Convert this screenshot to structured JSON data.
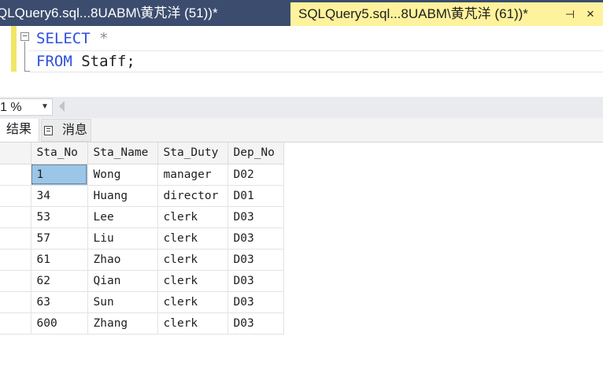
{
  "tabs": {
    "inactive_title": "QLQuery6.sql...8UABM\\黄芃洋 (51))*",
    "active_title": "SQLQuery5.sql...8UABM\\黄芃洋 (61))*",
    "pin_glyph": "⊣",
    "close_glyph": "×"
  },
  "editor": {
    "line1": {
      "keyword": "SELECT",
      "operator": "*"
    },
    "line2": {
      "keyword": "FROM",
      "identifier": "Staff;"
    }
  },
  "zoom": {
    "value": "1 %"
  },
  "result_tabs": {
    "results_label": "结果",
    "messages_label": "消息"
  },
  "grid": {
    "columns": [
      "Sta_No",
      "Sta_Name",
      "Sta_Duty",
      "Dep_No"
    ],
    "rows": [
      [
        "1",
        "Wong",
        "manager",
        "D02"
      ],
      [
        "34",
        "Huang",
        "director",
        "D01"
      ],
      [
        "53",
        "Lee",
        "clerk",
        "D03"
      ],
      [
        "57",
        "Liu",
        "clerk",
        "D03"
      ],
      [
        "61",
        "Zhao",
        "clerk",
        "D03"
      ],
      [
        "62",
        "Qian",
        "clerk",
        "D03"
      ],
      [
        "63",
        "Sun",
        "clerk",
        "D03"
      ],
      [
        "600",
        "Zhang",
        "clerk",
        "D03"
      ]
    ],
    "selected_cell_color": "#9cc6e8"
  }
}
